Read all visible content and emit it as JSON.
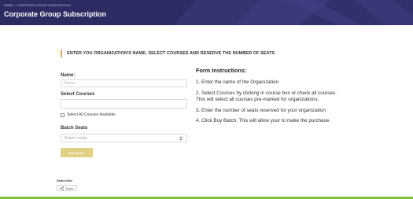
{
  "colors": {
    "hero_bg": "#2c2c63",
    "heading_accent": "#d2b24a",
    "button_bg": "#e1cf82",
    "bottom_bar": "#7bc043"
  },
  "breadcrumb": {
    "home": "HOME",
    "current": "CORPORATE GROUP SUBSCRIPTION"
  },
  "page": {
    "title": "Corporate Group Subscription"
  },
  "section": {
    "heading": "ENTER YOU ORGANIZATION'S NAME;  SELECT COURSES AND RESERVE THE NUMBER OF SEATS"
  },
  "form": {
    "name_label": "Name:",
    "name_placeholder": "Name:",
    "name_value": "",
    "courses_label": "Select Courses",
    "courses_value": "",
    "select_all_label": "Select All Courses Available",
    "batch_label": "Batch Seats",
    "batch_value": "Batch seats",
    "buy_button": "Buy Batch"
  },
  "instructions": {
    "title": "Form Instructions:",
    "items": [
      "1. Enter the name of the Organization",
      "2. Select Courses by clicking in course box or check all courses. This will select all courses pre-marked for organizations.",
      "3. Enter the number of seats reserved for your organization",
      "4. Click Buy Batch. This will allow your to make the purchase."
    ]
  },
  "share": {
    "title": "Share this:",
    "button": "Share",
    "icon": "share-icon"
  }
}
